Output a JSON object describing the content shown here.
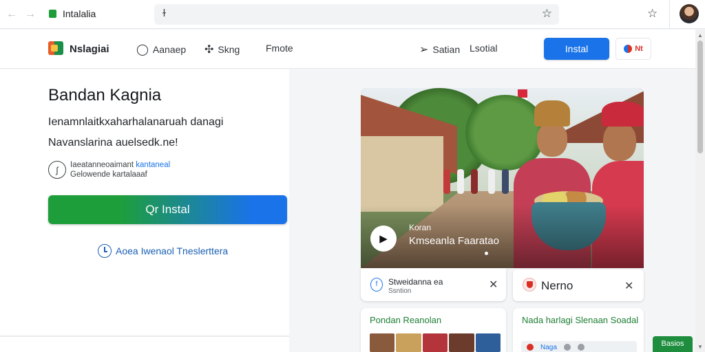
{
  "browser": {
    "tab_title": "Intalalia",
    "nav_back": "←",
    "nav_forward": "→",
    "omnibox_cursor": "ɫ",
    "star": "☆"
  },
  "header": {
    "brand": "Nslagiai",
    "nav": [
      {
        "label": "Aanaep",
        "icon": "chat-icon"
      },
      {
        "label": "Skng",
        "icon": "puzzle-icon"
      },
      {
        "label": "Fmote",
        "icon": ""
      },
      {
        "label": "Satian",
        "icon": "send-icon"
      },
      {
        "label": "Lsotial",
        "icon": ""
      }
    ],
    "install_label": "Instal",
    "lang_label": "Nt"
  },
  "hero": {
    "title": "Bandan Kagnia",
    "line1": "Ienamnlaitkxaharhalanaruah danagi",
    "line2": "Navanslarina auelsedk.ne!",
    "info_line1_prefix": "Iaeatanneoaimant",
    "info_line1_link": "kantaneal",
    "info_line2": "Gelowende kartalaaaf",
    "cta_label": "Qr Instal",
    "secondary_link": "Aoea Iwenaol Tneslerttera"
  },
  "video": {
    "eyebrow": "Koran",
    "title": "Kmseanla Faaratao",
    "play_icon": "▶"
  },
  "mini_cards": [
    {
      "title": "Stweidanna ea",
      "sub": "Ssntion",
      "icon": "f",
      "close": "✕"
    },
    {
      "title": "Nerno",
      "close": "✕"
    }
  ],
  "lower_cards": [
    {
      "title": "Pondan Reanolan"
    },
    {
      "title": "Nada harlagi Slenaan Soadal",
      "pill": "Naga"
    }
  ],
  "float_button": "Basios",
  "colors": {
    "accent_blue": "#1a73e8",
    "accent_green": "#1e9e3b"
  }
}
